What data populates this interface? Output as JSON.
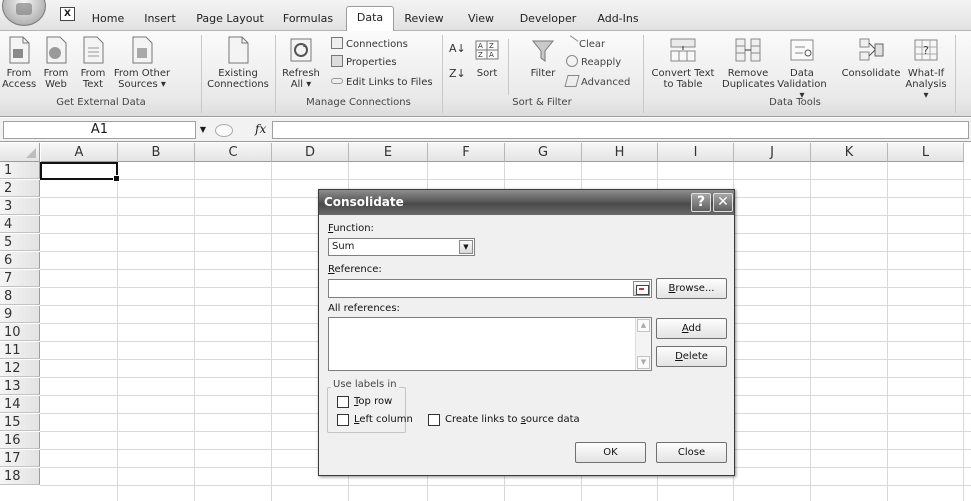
{
  "tabs": [
    {
      "label": "Home",
      "active": false
    },
    {
      "label": "Insert",
      "active": false
    },
    {
      "label": "Page Layout",
      "active": false
    },
    {
      "label": "Formulas",
      "active": false
    },
    {
      "label": "Data",
      "active": true
    },
    {
      "label": "Review",
      "active": false
    },
    {
      "label": "View",
      "active": false
    },
    {
      "label": "Developer",
      "active": false
    },
    {
      "label": "Add-Ins",
      "active": false
    }
  ],
  "ribbon": {
    "get_external": {
      "group_label": "Get External Data",
      "buttons": [
        {
          "line1": "From",
          "line2": "Access",
          "icon": "access-icon"
        },
        {
          "line1": "From",
          "line2": "Web",
          "icon": "web-icon"
        },
        {
          "line1": "From",
          "line2": "Text",
          "icon": "text-file-icon"
        },
        {
          "line1": "From Other",
          "line2": "Sources ▾",
          "icon": "other-sources-icon"
        }
      ]
    },
    "existing": {
      "line1": "Existing",
      "line2": "Connections",
      "icon": "existing-connections-icon"
    },
    "manage_connections": {
      "group_label": "Manage Connections",
      "refresh_line1": "Refresh",
      "refresh_line2": "All ▾",
      "connections": "Connections",
      "properties": "Properties",
      "edit_links": "Edit Links to Files"
    },
    "sort_filter": {
      "group_label": "Sort & Filter",
      "sort": "Sort",
      "filter": "Filter",
      "clear": "Clear",
      "reapply": "Reapply",
      "advanced": "Advanced"
    },
    "data_tools": {
      "group_label": "Data Tools",
      "convert_line1": "Convert Text",
      "convert_line2": "to Table",
      "remove_line1": "Remove",
      "remove_line2": "Duplicates",
      "validation_line1": "Data",
      "validation_line2": "Validation ▾",
      "consolidate": "Consolidate",
      "whatif_line1": "What-If",
      "whatif_line2": "Analysis ▾"
    }
  },
  "formula_bar": {
    "name_box": "A1",
    "fx": "fx",
    "formula": ""
  },
  "sheet": {
    "columns": [
      "A",
      "B",
      "C",
      "D",
      "E",
      "F",
      "G",
      "H",
      "I",
      "J",
      "K",
      "L"
    ],
    "rows": [
      "1",
      "2",
      "3",
      "4",
      "5",
      "6",
      "7",
      "8",
      "9",
      "10",
      "11",
      "12",
      "13",
      "14",
      "15",
      "16",
      "17",
      "18"
    ],
    "active_cell": "A1"
  },
  "dialog": {
    "title": "Consolidate",
    "help_button": "?",
    "close_button": "✕",
    "function_label_u": "F",
    "function_label_rest": "unction:",
    "function_value": "Sum",
    "reference_label_u": "R",
    "reference_label_rest": "eference:",
    "reference_value": "",
    "browse_u": "B",
    "browse_rest": "rowse...",
    "all_refs_label": "All references:",
    "add_u": "A",
    "add_rest": "dd",
    "delete_u": "D",
    "delete_rest": "elete",
    "use_labels_legend": "Use labels in",
    "top_row_u": "T",
    "top_row_rest": "op row",
    "top_row_checked": false,
    "left_col_u": "L",
    "left_col_rest": "eft column",
    "left_col_checked": false,
    "links_pre": "Create links to ",
    "links_u": "s",
    "links_rest": "ource data",
    "links_checked": false,
    "ok": "OK",
    "close": "Close"
  }
}
